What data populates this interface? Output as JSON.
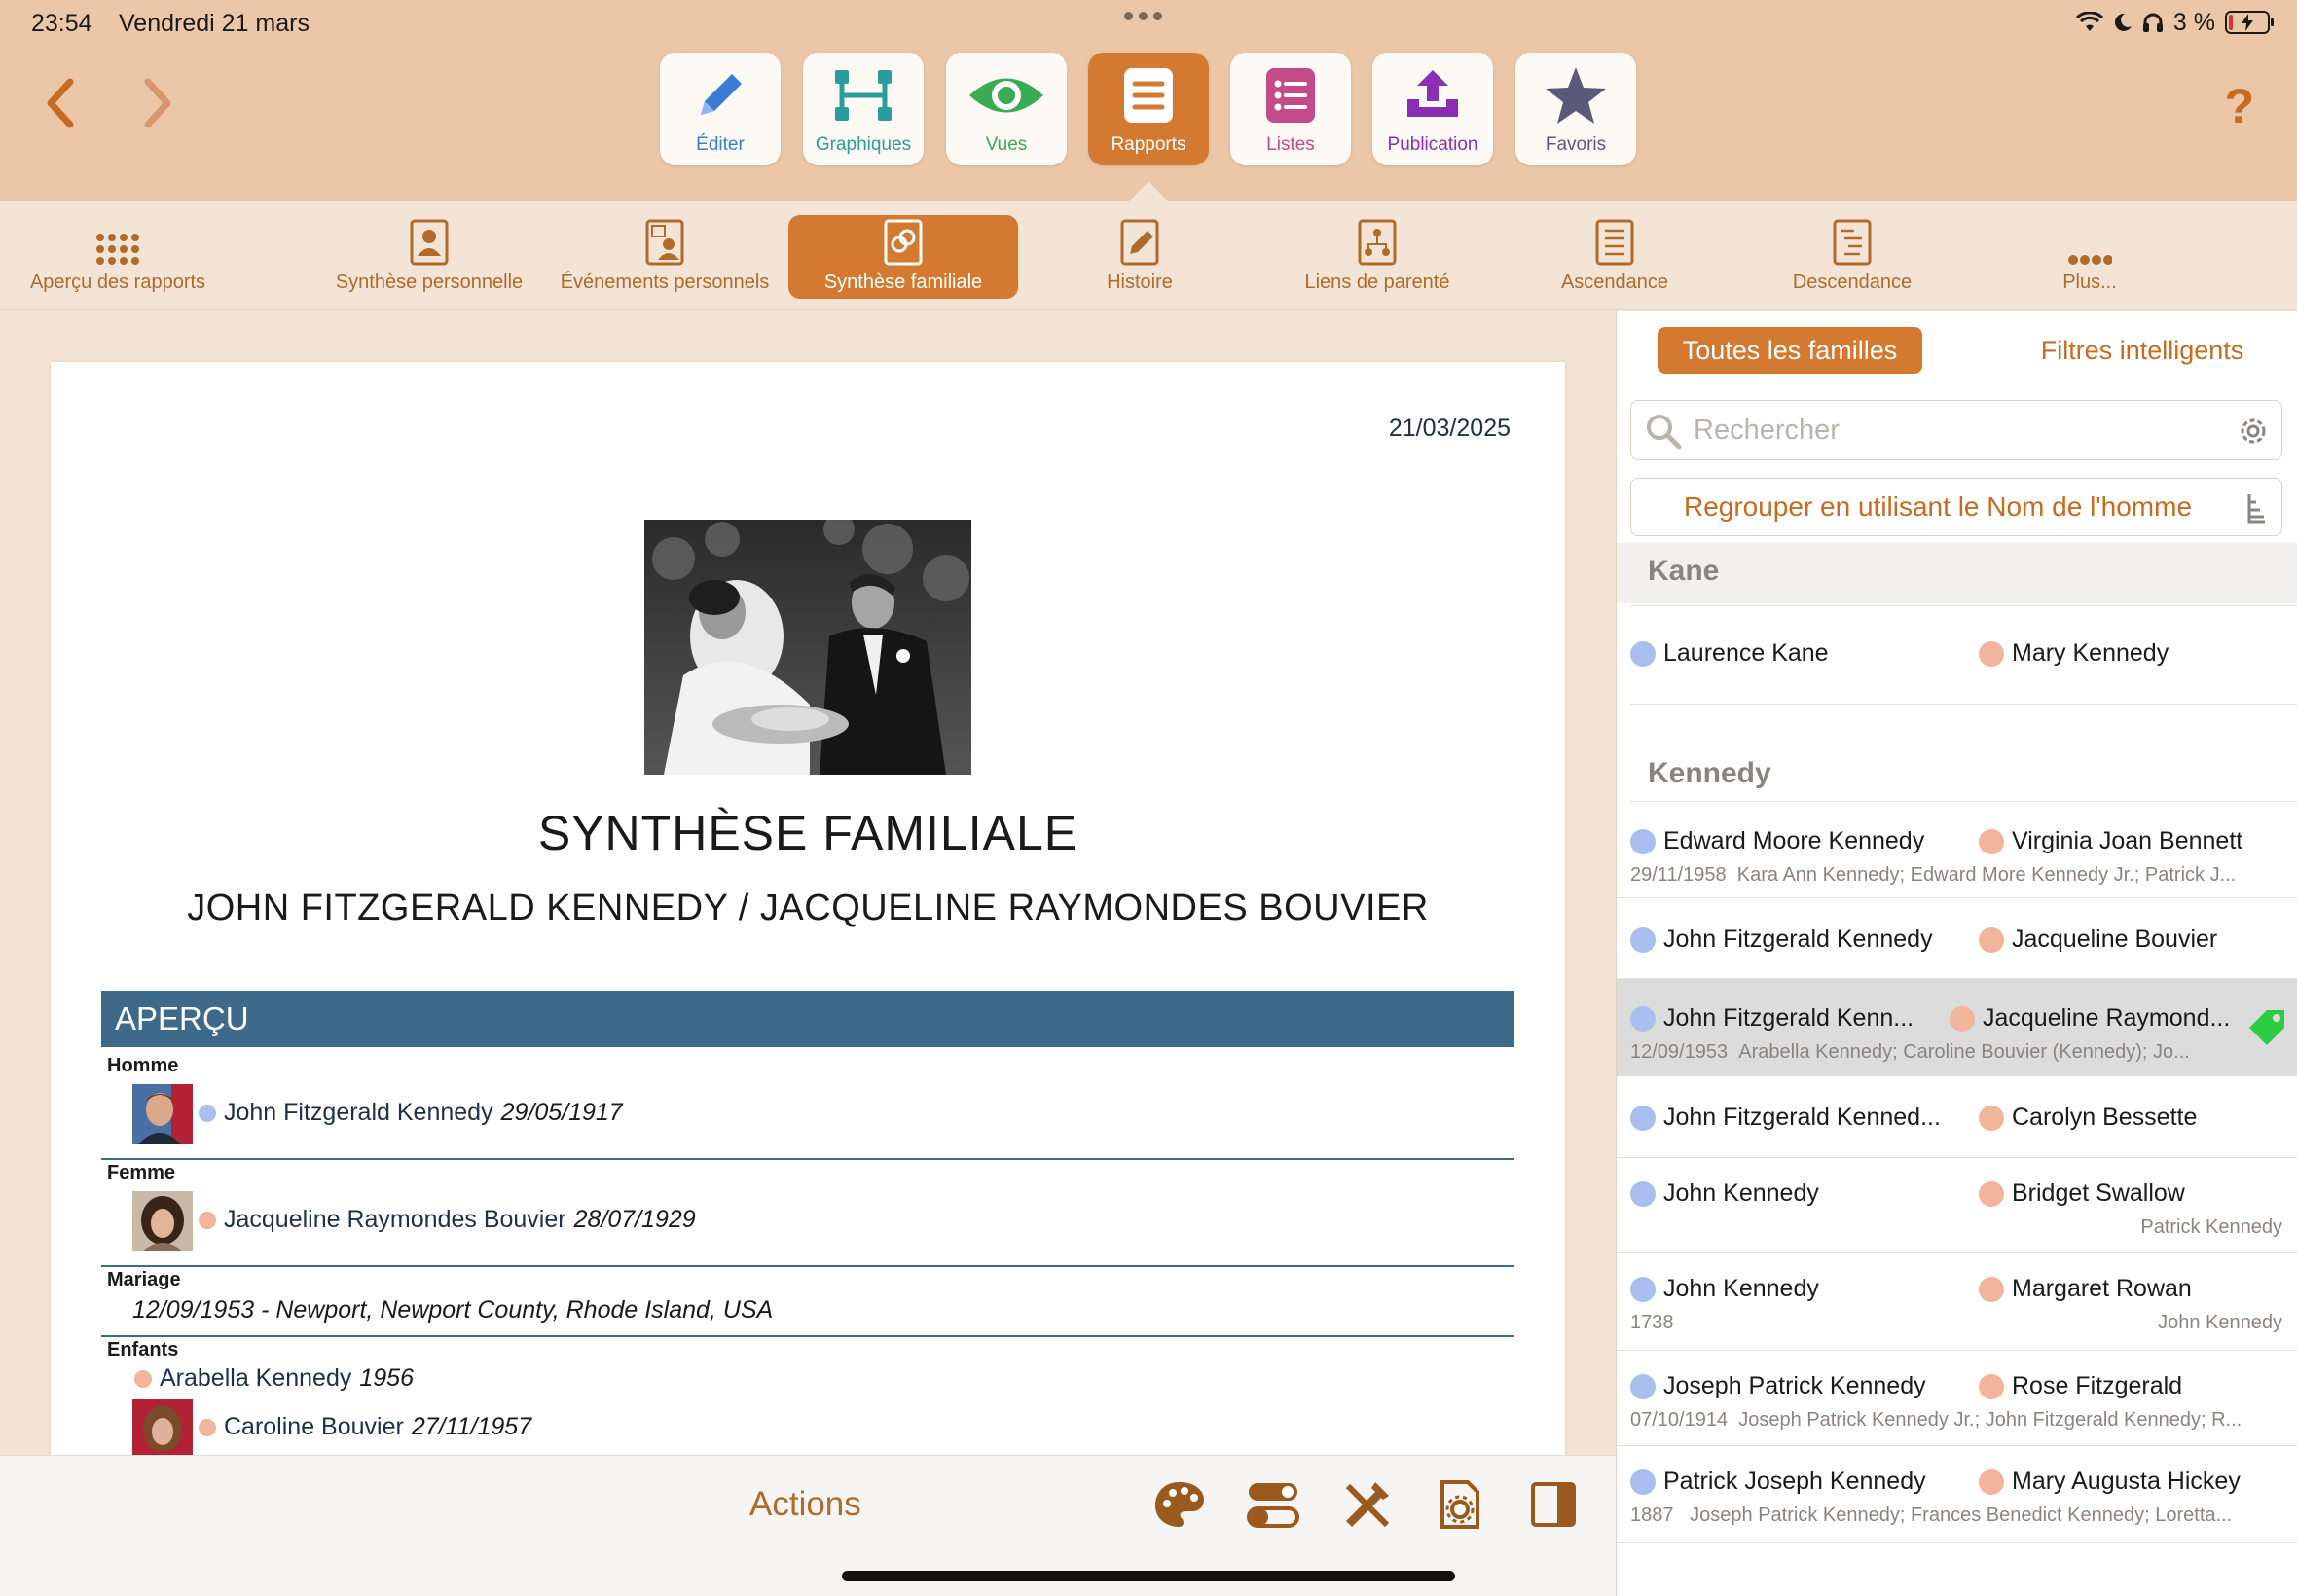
{
  "status": {
    "time": "23:54",
    "date": "Vendredi 21 mars",
    "battery": "3 %"
  },
  "toolbar": {
    "buttons": [
      {
        "label": "Éditer",
        "icon": "pencil-icon",
        "color": "#3a7bd5"
      },
      {
        "label": "Graphiques",
        "icon": "chart-tree-icon",
        "color": "#2a9d9a"
      },
      {
        "label": "Vues",
        "icon": "eye-icon",
        "color": "#3aaa55"
      },
      {
        "label": "Rapports",
        "icon": "report-lines-icon",
        "color": "#ffffff"
      },
      {
        "label": "Listes",
        "icon": "list-icon",
        "color": "#c44a8a"
      },
      {
        "label": "Publication",
        "icon": "upload-icon",
        "color": "#8a2fb5"
      },
      {
        "label": "Favoris",
        "icon": "star-icon",
        "color": "#5a5a78"
      }
    ],
    "help": "?"
  },
  "tabs": [
    {
      "label": "Aperçu des rapports",
      "icon": "grid-dots-icon"
    },
    {
      "label": "Synthèse personnelle",
      "icon": "person-doc-icon"
    },
    {
      "label": "Événements personnels",
      "icon": "calendar-person-icon"
    },
    {
      "label": "Synthèse familiale",
      "icon": "rings-doc-icon"
    },
    {
      "label": "Histoire",
      "icon": "pencil-doc-icon"
    },
    {
      "label": "Liens de parenté",
      "icon": "relation-doc-icon"
    },
    {
      "label": "Ascendance",
      "icon": "ancestry-doc-icon"
    },
    {
      "label": "Descendance",
      "icon": "descendancy-doc-icon"
    },
    {
      "label": "Plus...",
      "icon": "more-dots-icon"
    }
  ],
  "report": {
    "date": "21/03/2025",
    "title": "SYNTHÈSE FAMILIALE",
    "subtitle": "JOHN FITZGERALD KENNEDY / JACQUELINE RAYMONDES BOUVIER",
    "section": "APERÇU",
    "husband_label": "Homme",
    "husband_name": "John Fitzgerald Kennedy",
    "husband_date": "29/05/1917",
    "wife_label": "Femme",
    "wife_name": "Jacqueline Raymondes Bouvier",
    "wife_date": "28/07/1929",
    "marriage_label": "Mariage",
    "marriage_text": "12/09/1953 - Newport, Newport County, Rhode Island, USA",
    "children_label": "Enfants",
    "children": [
      {
        "name": "Arabella Kennedy",
        "date": "1956"
      },
      {
        "name": "Caroline Bouvier",
        "date": "27/11/1957"
      }
    ]
  },
  "actions": {
    "label": "Actions",
    "buttons": [
      "palette-icon",
      "toggles-icon",
      "tools-icon",
      "doc-settings-icon",
      "sidebar-icon"
    ]
  },
  "panel": {
    "seg_all": "Toutes les familles",
    "seg_smart": "Filtres intelligents",
    "search_placeholder": "Rechercher",
    "group_by": "Regrouper en utilisant le Nom de l'homme",
    "sections": [
      {
        "name": "Kane",
        "families": [
          {
            "husband": "Laurence Kane",
            "wife": "Mary Kennedy",
            "date": "",
            "children": "",
            "right": ""
          }
        ]
      },
      {
        "name": "Kennedy",
        "families": [
          {
            "husband": "Edward Moore Kennedy",
            "wife": "Virginia Joan Bennett",
            "date": "29/11/1958",
            "children": "Kara Ann Kennedy; Edward More Kennedy Jr.; Patrick J...",
            "right": ""
          },
          {
            "husband": "John Fitzgerald Kennedy",
            "wife": "Jacqueline Bouvier",
            "date": "",
            "children": "",
            "right": ""
          },
          {
            "husband": "John Fitzgerald Kenn...",
            "wife": "Jacqueline Raymond...",
            "date": "12/09/1953",
            "children": "Arabella Kennedy; Caroline Bouvier (Kennedy); Jo...",
            "right": ""
          },
          {
            "husband": "John Fitzgerald Kenned...",
            "wife": "Carolyn Bessette",
            "date": "",
            "children": "",
            "right": ""
          },
          {
            "husband": "John Kennedy",
            "wife": "Bridget Swallow",
            "date": "",
            "children": "",
            "right": "Patrick Kennedy"
          },
          {
            "husband": "John Kennedy",
            "wife": "Margaret Rowan",
            "date": "1738",
            "children": "",
            "right": "John Kennedy"
          },
          {
            "husband": "Joseph Patrick Kennedy",
            "wife": "Rose Fitzgerald",
            "date": "07/10/1914",
            "children": "Joseph Patrick Kennedy Jr.; John Fitzgerald Kennedy; R...",
            "right": ""
          },
          {
            "husband": "Patrick Joseph Kennedy",
            "wife": "Mary Augusta Hickey",
            "date": "1887",
            "children": "Joseph Patrick Kennedy; Frances Benedict Kennedy; Loretta...",
            "right": ""
          }
        ]
      }
    ]
  },
  "colors": {
    "accent": "#d37a30",
    "toolbar_bg": "#ecc7a7",
    "section_blue": "#3d6a8b",
    "male_dot": "#a9bff0",
    "female_dot": "#f0b59b",
    "tag_green": "#2ecc40"
  }
}
